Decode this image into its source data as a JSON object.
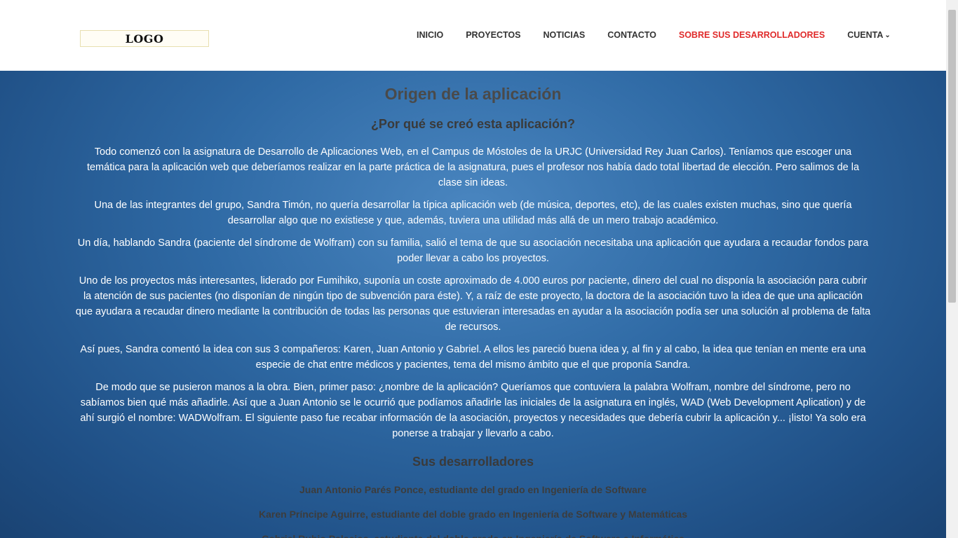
{
  "header": {
    "logo": "LOGO",
    "nav": [
      {
        "label": "INICIO",
        "active": false
      },
      {
        "label": "PROYECTOS",
        "active": false
      },
      {
        "label": "NOTICIAS",
        "active": false
      },
      {
        "label": "CONTACTO",
        "active": false
      },
      {
        "label": "SOBRE SUS DESARROLLADORES",
        "active": true
      },
      {
        "label": "CUENTA",
        "active": false,
        "icon": "chevron-down-icon"
      }
    ]
  },
  "main": {
    "title": "Origen de la aplicación",
    "subtitle": "¿Por qué se creó esta aplicación?",
    "paragraphs": [
      "Todo comenzó con la asignatura de Desarrollo de Aplicaciones Web, en el Campus de Móstoles de la URJC (Universidad Rey Juan Carlos). Teníamos que escoger una temática para la aplicación web que deberíamos realizar en la parte práctica de la asignatura, pues el profesor nos había dado total libertad de elección. Pero salimos de la clase sin ideas.",
      "Una de las integrantes del grupo, Sandra Timón, no quería desarrollar la típica aplicación web (de música, deportes, etc), de las cuales existen muchas, sino que quería desarrollar algo que no existiese y que, además, tuviera una utilidad más allá de un mero trabajo académico.",
      "Un día, hablando Sandra (paciente del síndrome de Wolfram) con su familia, salió el tema de que su asociación necesitaba una aplicación que ayudara a recaudar fondos para poder llevar a cabo los proyectos.",
      "Uno de los proyectos más interesantes, liderado por Fumihiko, suponía un coste aproximado de 4.000 euros por paciente, dinero del cual no disponía la asociación para cubrir la atención de sus pacientes (no disponían de ningún tipo de subvención para éste). Y, a raíz de este proyecto, la doctora de la asociación tuvo la idea de que una aplicación que ayudara a recaudar dinero mediante la contribución de todas las personas que estuvieran interesadas en ayudar a la asociación podía ser una solución al problema de falta de recursos.",
      "Así pues, Sandra comentó la idea con sus 3 compañeros: Karen, Juan Antonio y Gabriel. A ellos les pareció buena idea y, al fin y al cabo, la idea que tenían en mente era una especie de chat entre médicos y pacientes, tema del mismo ámbito que el que proponía Sandra.",
      "De modo que se pusieron manos a la obra. Bien, primer paso: ¿nombre de la aplicación? Queríamos que contuviera la palabra Wolfram, nombre del síndrome, pero no sabíamos bien qué más añadirle. Así que a Juan Antonio se le ocurrió que podíamos añadirle las iniciales de la asignatura en inglés, WAD (Web Development Aplication) y de ahí surgió el nombre: WADWolfram. El siguiente paso fue recabar información de la asociación, proyectos y necesidades que debería cubrir la aplicación y... ¡listo! Ya solo era ponerse a trabajar y llevarlo a cabo."
    ],
    "developers_title": "Sus desarrolladores",
    "developers": [
      "Juan Antonio Parés Ponce, estudiante del grado en Ingeniería de Software",
      "Karen Príncipe Aguirre, estudiante del doble grado en Ingeniería de Software y Matemáticas",
      "Gabriel Rubio Palacios, estudiante del doble grado en Ingeniería de Software e Informática"
    ]
  },
  "colors": {
    "active_nav": "#e02a2a",
    "background_blue": "#2f6aa5"
  }
}
